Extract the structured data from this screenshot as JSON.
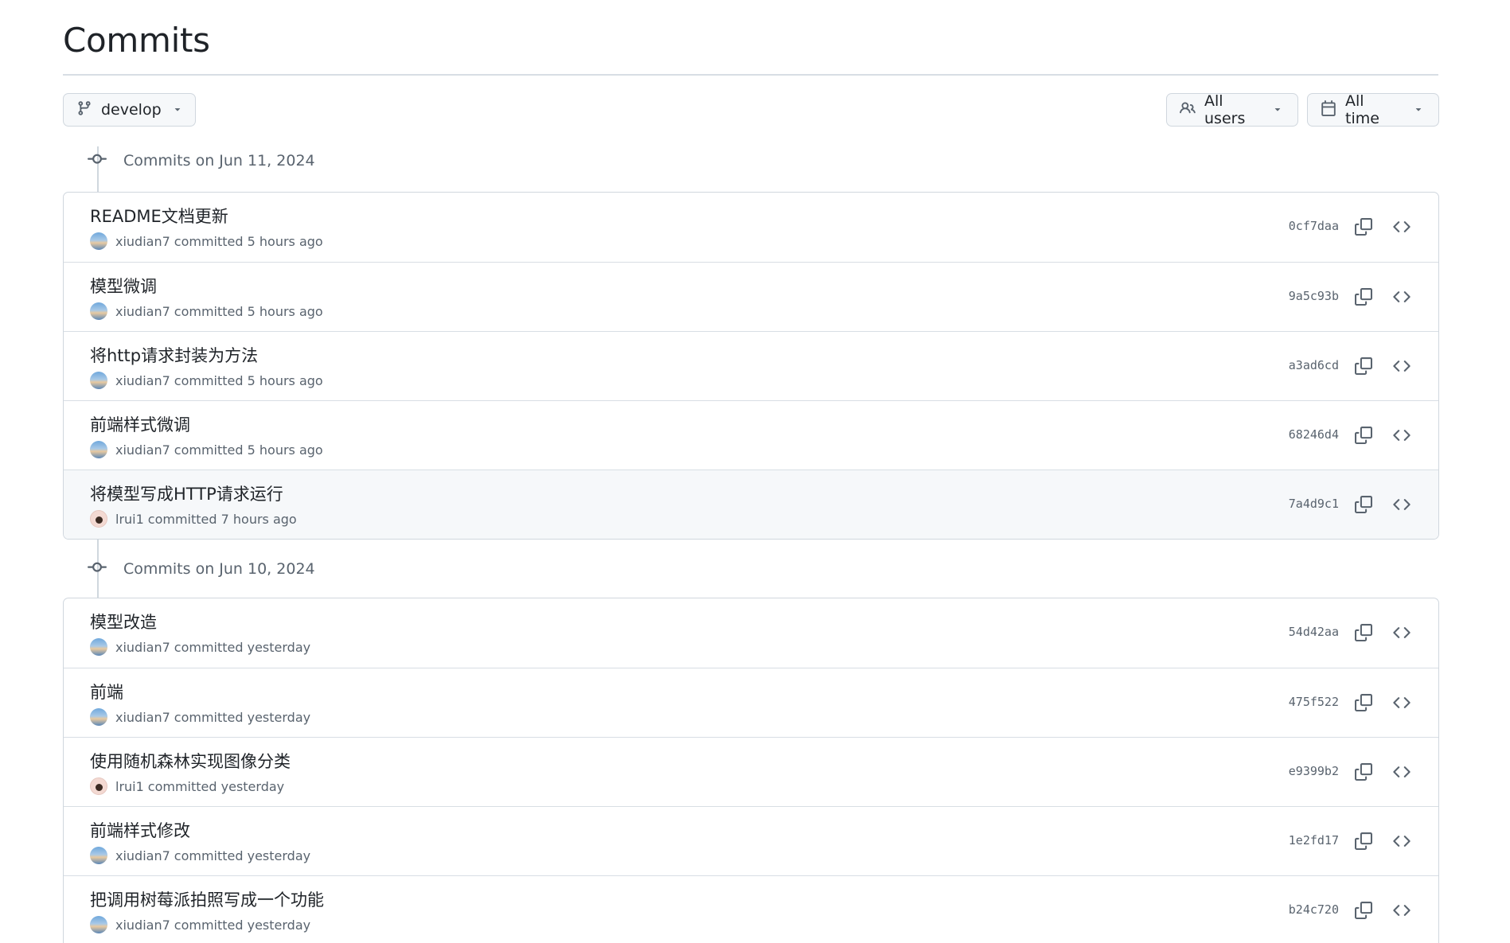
{
  "page": {
    "title": "Commits"
  },
  "toolbar": {
    "branch_label": "develop",
    "users_label": "All users",
    "time_label": "All time",
    "icons": [
      "git-branch-icon",
      "people-icon",
      "calendar-icon",
      "caret-down-icon"
    ]
  },
  "groups": [
    {
      "header": "Commits on Jun 11, 2024",
      "commits": [
        {
          "message": "README文档更新",
          "author": "xiudian7",
          "text": "committed 5 hours ago",
          "sha": "0cf7daa",
          "avatar": "sky"
        },
        {
          "message": "模型微调",
          "author": "xiudian7",
          "text": "committed 5 hours ago",
          "sha": "9a5c93b",
          "avatar": "sky"
        },
        {
          "message": "将http请求封装为方法",
          "author": "xiudian7",
          "text": "committed 5 hours ago",
          "sha": "a3ad6cd",
          "avatar": "sky"
        },
        {
          "message": "前端样式微调",
          "author": "xiudian7",
          "text": "committed 5 hours ago",
          "sha": "68246d4",
          "avatar": "sky"
        },
        {
          "message": "将模型写成HTTP请求运行",
          "author": "lrui1",
          "text": "committed 7 hours ago",
          "sha": "7a4d9c1",
          "avatar": "person"
        }
      ]
    },
    {
      "header": "Commits on Jun 10, 2024",
      "commits": [
        {
          "message": "模型改造",
          "author": "xiudian7",
          "text": "committed yesterday",
          "sha": "54d42aa",
          "avatar": "sky"
        },
        {
          "message": "前端",
          "author": "xiudian7",
          "text": "committed yesterday",
          "sha": "475f522",
          "avatar": "sky"
        },
        {
          "message": "使用随机森林实现图像分类",
          "author": "lrui1",
          "text": "committed yesterday",
          "sha": "e9399b2",
          "avatar": "person"
        },
        {
          "message": "前端样式修改",
          "author": "xiudian7",
          "text": "committed yesterday",
          "sha": "1e2fd17",
          "avatar": "sky"
        },
        {
          "message": "把调用树莓派拍照写成一个功能",
          "author": "xiudian7",
          "text": "committed yesterday",
          "sha": "b24c720",
          "avatar": "sky"
        }
      ]
    }
  ],
  "colors": {
    "border": "#d0d7de",
    "muted_text": "#59636e",
    "text": "#1f2328",
    "button_bg": "#f6f8fa"
  }
}
